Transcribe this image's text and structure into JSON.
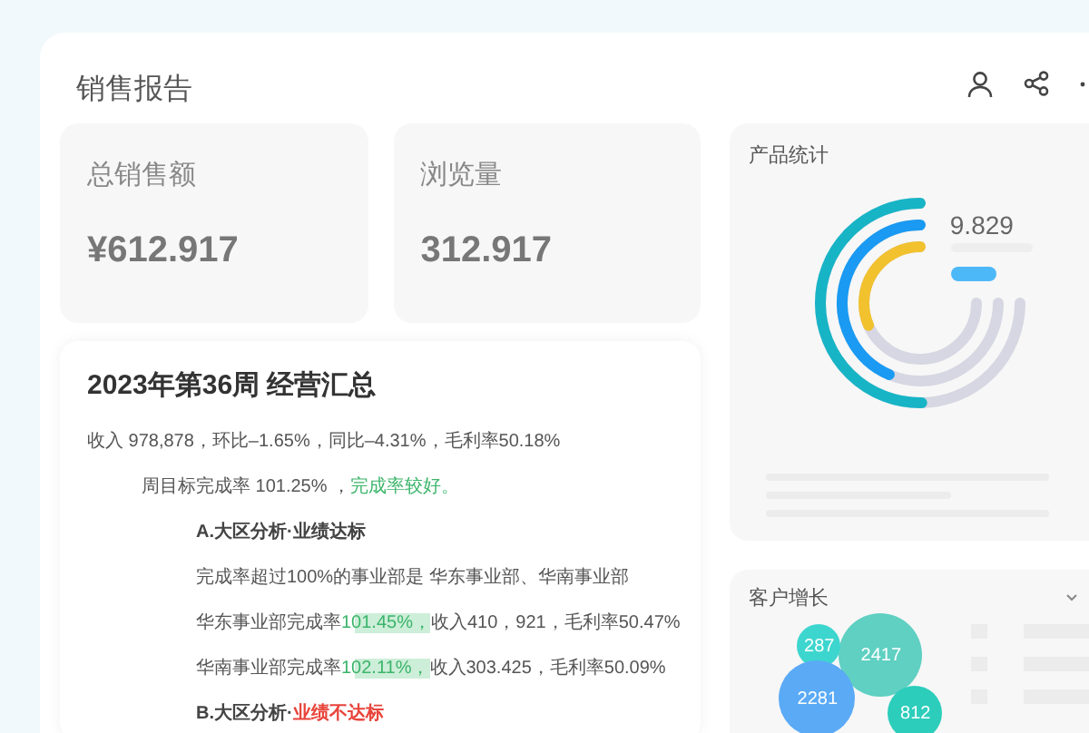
{
  "header": {
    "title": "销售报告"
  },
  "stats": [
    {
      "label": "总销售额",
      "value": "¥612.917"
    },
    {
      "label": "浏览量",
      "value": "312.917"
    }
  ],
  "summary": {
    "title": "2023年第36周 经营汇总",
    "lines": [
      {
        "kind": "text",
        "segments": [
          {
            "kind": "plain",
            "text": "收入 978,878，环比–1.65%，同比–4.31%，毛利率50.18%"
          }
        ],
        "children": [
          {
            "kind": "text",
            "segments": [
              {
                "kind": "plain",
                "text": "周目标完成率 101.25% ，"
              },
              {
                "kind": "good",
                "text": "完成率较好。"
              }
            ],
            "children": [
              {
                "kind": "heading",
                "segments": [
                  {
                    "kind": "plain",
                    "text": "A.大区分析·业绩达标"
                  }
                ]
              },
              {
                "kind": "text",
                "segments": [
                  {
                    "kind": "plain",
                    "text": "完成率超过100%的事业部是 华东事业部、华南事业部"
                  }
                ]
              },
              {
                "kind": "text",
                "segments": [
                  {
                    "kind": "plain",
                    "text": "华东事业部完成率"
                  },
                  {
                    "kind": "highlight",
                    "text": "101.45%，"
                  },
                  {
                    "kind": "plain",
                    "text": "收入410，921，毛利率50.47%"
                  }
                ]
              },
              {
                "kind": "text",
                "segments": [
                  {
                    "kind": "plain",
                    "text": "华南事业部完成率"
                  },
                  {
                    "kind": "highlight",
                    "text": "102.11%，"
                  },
                  {
                    "kind": "plain",
                    "text": "收入303.425，毛利率50.09%"
                  }
                ]
              },
              {
                "kind": "heading",
                "segments": [
                  {
                    "kind": "plain",
                    "text": "B.大区分析·"
                  },
                  {
                    "kind": "bad",
                    "text": "业绩不达标"
                  }
                ]
              }
            ]
          }
        ]
      }
    ]
  },
  "product_stats": {
    "title": "产品统计",
    "value": "9.829"
  },
  "customer_growth": {
    "title": "客户增长",
    "bubbles": [
      {
        "label": "2417",
        "color": "#5fd0c2"
      },
      {
        "label": "287",
        "color": "#3dd6cf"
      },
      {
        "label": "2281",
        "color": "#5aaaf6"
      },
      {
        "label": "812",
        "color": "#2ccdbb"
      }
    ]
  }
}
